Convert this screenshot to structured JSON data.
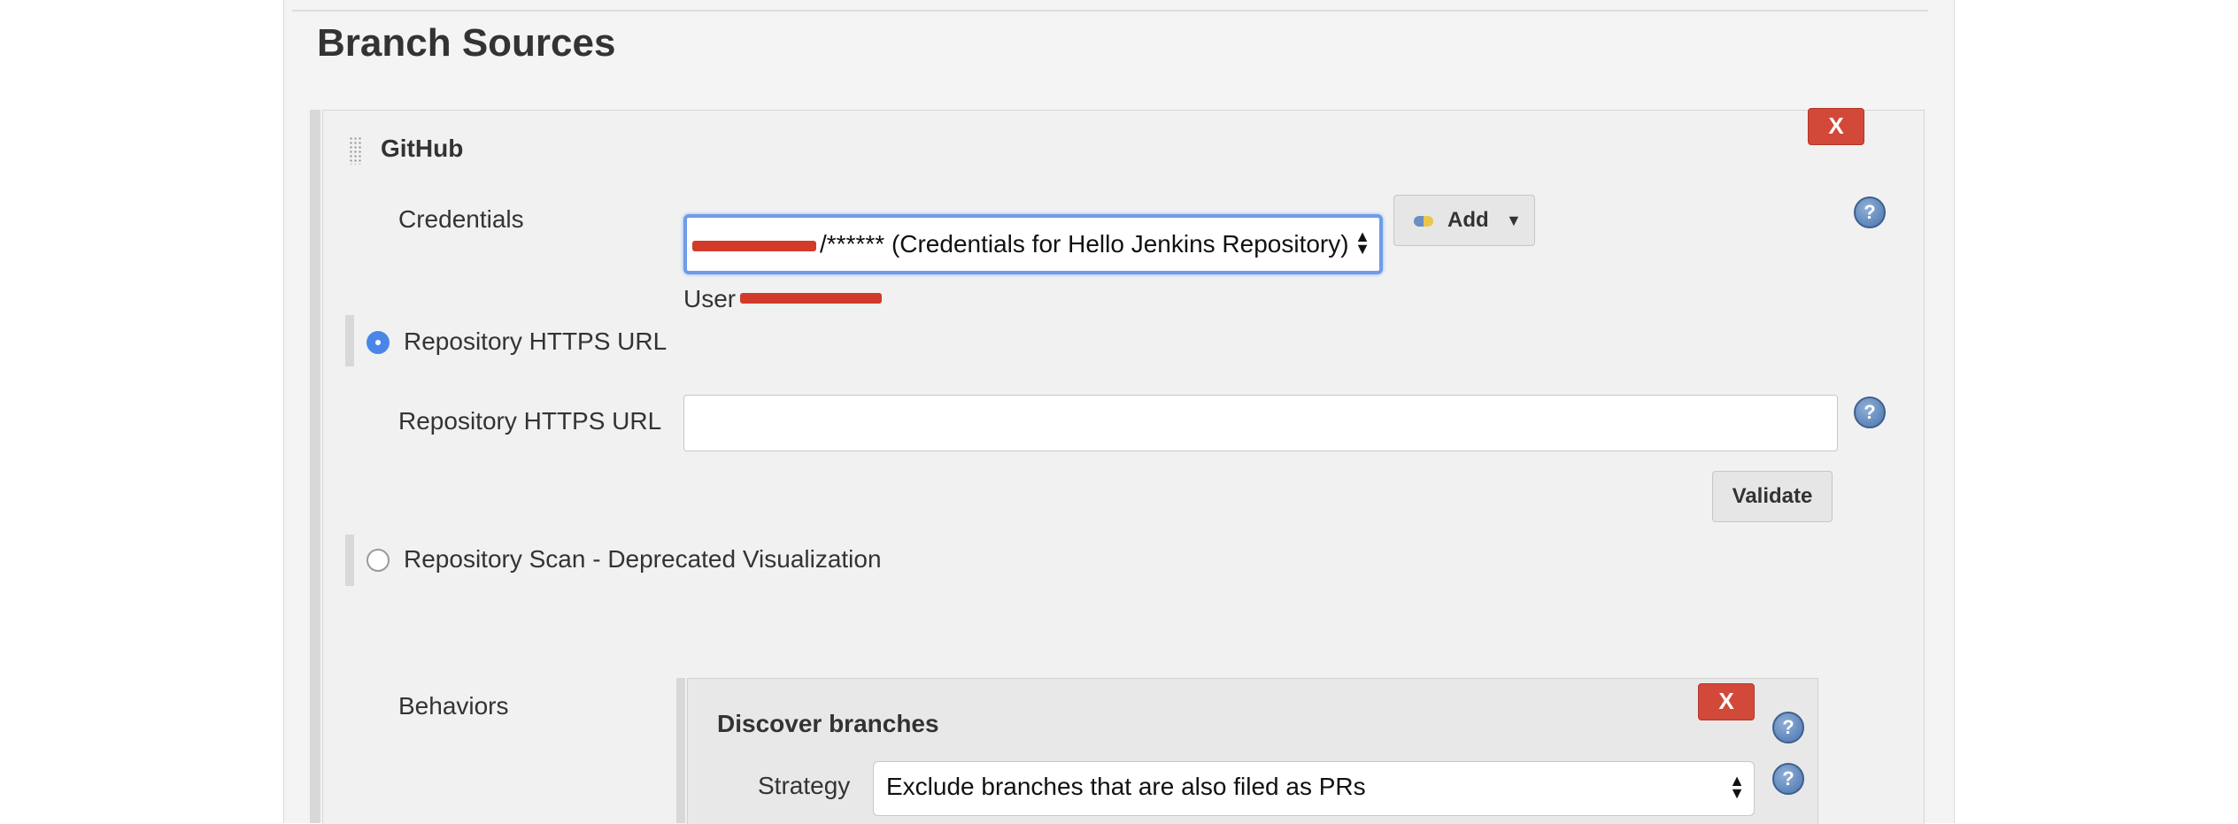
{
  "section": {
    "title": "Branch Sources"
  },
  "github": {
    "title": "GitHub",
    "remove_label": "X",
    "credentials": {
      "label": "Credentials",
      "selected": "/****** (Credentials for Hello Jenkins Repository)",
      "user_prefix": "User",
      "add_label": "Add"
    },
    "https_option": {
      "label": "Repository HTTPS URL",
      "selected": true
    },
    "https_url": {
      "label": "Repository HTTPS URL",
      "value": "",
      "validate_label": "Validate"
    },
    "scan_option": {
      "label": "Repository Scan - Deprecated Visualization",
      "selected": false
    },
    "behaviors": {
      "label": "Behaviors",
      "discover": {
        "title": "Discover branches",
        "remove_label": "X",
        "strategy_label": "Strategy",
        "strategy_value": "Exclude branches that are also filed as PRs"
      }
    }
  },
  "help_glyph": "?",
  "colors": {
    "remove_red": "#d24939",
    "focus_blue": "#6e9ce8",
    "radio_blue": "#4a86e8",
    "help_blue": "#4a74ad"
  }
}
